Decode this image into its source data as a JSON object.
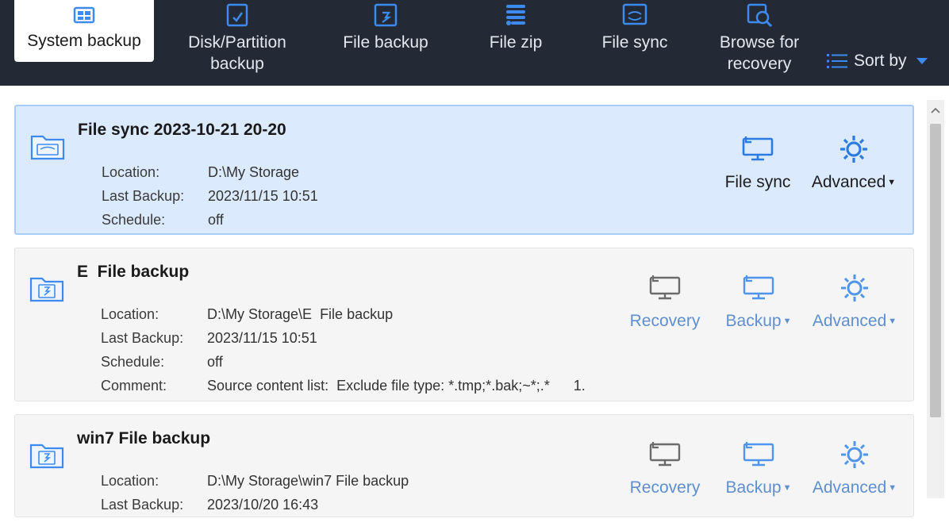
{
  "toolbar": {
    "items": [
      {
        "label": "System backup",
        "icon": "system-backup-icon"
      },
      {
        "label": "Disk/Partition\nbackup",
        "icon": "disk-backup-icon"
      },
      {
        "label": "File backup",
        "icon": "file-backup-icon"
      },
      {
        "label": "File zip",
        "icon": "file-zip-icon"
      },
      {
        "label": "File sync",
        "icon": "file-sync-icon"
      },
      {
        "label": "Browse for\nrecovery",
        "icon": "browse-recovery-icon"
      }
    ],
    "sort_label": "Sort by"
  },
  "colors": {
    "toolbar_bg": "#232a35",
    "accent": "#3d8bf0",
    "selected_bg": "#dbeafd",
    "card_bg": "#f5f5f6",
    "action_text": "#5e8fd0"
  },
  "tasks": [
    {
      "title": "File sync 2023-10-21 20-20",
      "location_key": "Location:",
      "location": "D:\\My Storage",
      "last_backup_key": "Last Backup:",
      "last_backup": "2023/11/15 10:51",
      "schedule_key": "Schedule:",
      "schedule": "off",
      "actions": [
        {
          "label": "File sync",
          "icon": "monitor-sync-icon"
        },
        {
          "label": "Advanced",
          "icon": "gear-icon",
          "dropdown": true
        }
      ]
    },
    {
      "title": "E  File backup",
      "location_key": "Location:",
      "location": "D:\\My Storage\\E  File backup",
      "last_backup_key": "Last Backup:",
      "last_backup": "2023/11/15 10:51",
      "schedule_key": "Schedule:",
      "schedule": "off",
      "comment_key": "Comment:",
      "comment": "Source content list:  Exclude file type: *.tmp;*.bak;~*;.*      1.",
      "actions": [
        {
          "label": "Recovery",
          "icon": "monitor-recovery-icon"
        },
        {
          "label": "Backup",
          "icon": "monitor-backup-icon",
          "dropdown": true
        },
        {
          "label": "Advanced",
          "icon": "gear-icon",
          "dropdown": true
        }
      ]
    },
    {
      "title": "win7 File backup",
      "location_key": "Location:",
      "location": "D:\\My Storage\\win7 File backup",
      "last_backup_key": "Last Backup:",
      "last_backup": "2023/10/20 16:43",
      "actions": [
        {
          "label": "Recovery",
          "icon": "monitor-recovery-icon"
        },
        {
          "label": "Backup",
          "icon": "monitor-backup-icon",
          "dropdown": true
        },
        {
          "label": "Advanced",
          "icon": "gear-icon",
          "dropdown": true
        }
      ]
    }
  ]
}
